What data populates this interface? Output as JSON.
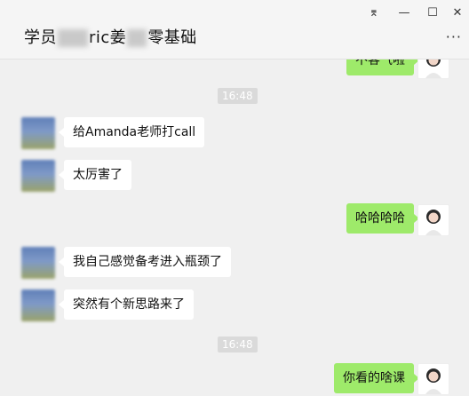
{
  "header": {
    "title_part1": "学员",
    "title_part2": "ric姜",
    "title_part3": "零基础",
    "more_glyph": "···",
    "window_controls": {
      "pin": "⌆",
      "minimize": "—",
      "maximize": "☐",
      "close": "✕"
    }
  },
  "messages": {
    "top_partial": "不客气啦",
    "ts1": "16:48",
    "m1": "给Amanda老师打call",
    "m2": "太厉害了",
    "m3": "哈哈哈哈",
    "m4": "我自己感觉备考进入瓶颈了",
    "m5": "突然有个新思路来了",
    "ts2": "16:48",
    "m6": "你看的啥课"
  },
  "colors": {
    "sent_bubble": "#9eea6a",
    "received_bubble": "#ffffff",
    "background": "#f0f0f0"
  }
}
